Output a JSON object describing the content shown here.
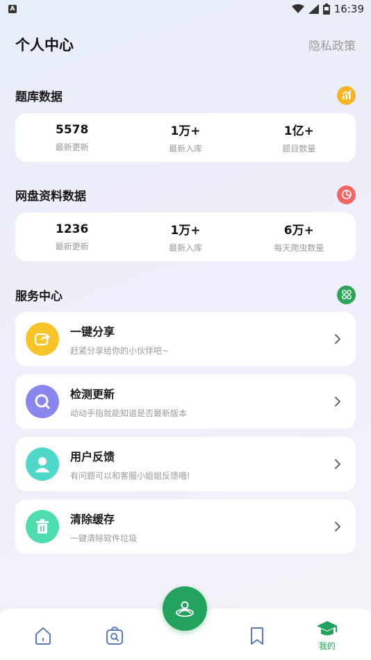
{
  "status_bar": {
    "time": "16:39",
    "notification_icon": "A"
  },
  "header": {
    "title": "个人中心",
    "privacy_link": "隐私政策"
  },
  "question_bank": {
    "title": "题库数据",
    "icon": "bar-chart-icon",
    "icon_color": "#f5b429",
    "stats": [
      {
        "value": "5578",
        "label": "最新更新"
      },
      {
        "value": "1万+",
        "label": "最新入库"
      },
      {
        "value": "1亿+",
        "label": "题目数量"
      }
    ]
  },
  "netdisk": {
    "title": "网盘资料数据",
    "icon": "pie-chart-icon",
    "icon_color": "#f06766",
    "stats": [
      {
        "value": "1236",
        "label": "最新更新"
      },
      {
        "value": "1万+",
        "label": "最新入库"
      },
      {
        "value": "6万+",
        "label": "每天爬虫数量"
      }
    ]
  },
  "services": {
    "title": "服务中心",
    "icon": "grid-icon",
    "icon_color": "#2ea45a",
    "items": [
      {
        "title": "一键分享",
        "subtitle": "赶紧分享给你的小伙伴吧~",
        "icon": "share-icon",
        "color": "#f7c52b"
      },
      {
        "title": "检测更新",
        "subtitle": "动动手指就能知道是否最新版本",
        "icon": "search-update-icon",
        "color": "#8a86ee"
      },
      {
        "title": "用户反馈",
        "subtitle": "有问题可以和客服小姐姐反馈哦!",
        "icon": "user-icon",
        "color": "#4fd8c7"
      },
      {
        "title": "清除缓存",
        "subtitle": "一键清除软件垃圾",
        "icon": "trash-icon",
        "color": "#4fddaf"
      }
    ]
  },
  "tabbar": {
    "accent": "#23a25d",
    "tabs": [
      {
        "label": "",
        "icon": "home-icon"
      },
      {
        "label": "",
        "icon": "search-bag-icon"
      },
      {
        "label": "",
        "icon": "community-icon"
      },
      {
        "label": "",
        "icon": "bookmark-icon"
      },
      {
        "label": "我的",
        "icon": "graduation-cap-icon"
      }
    ]
  }
}
